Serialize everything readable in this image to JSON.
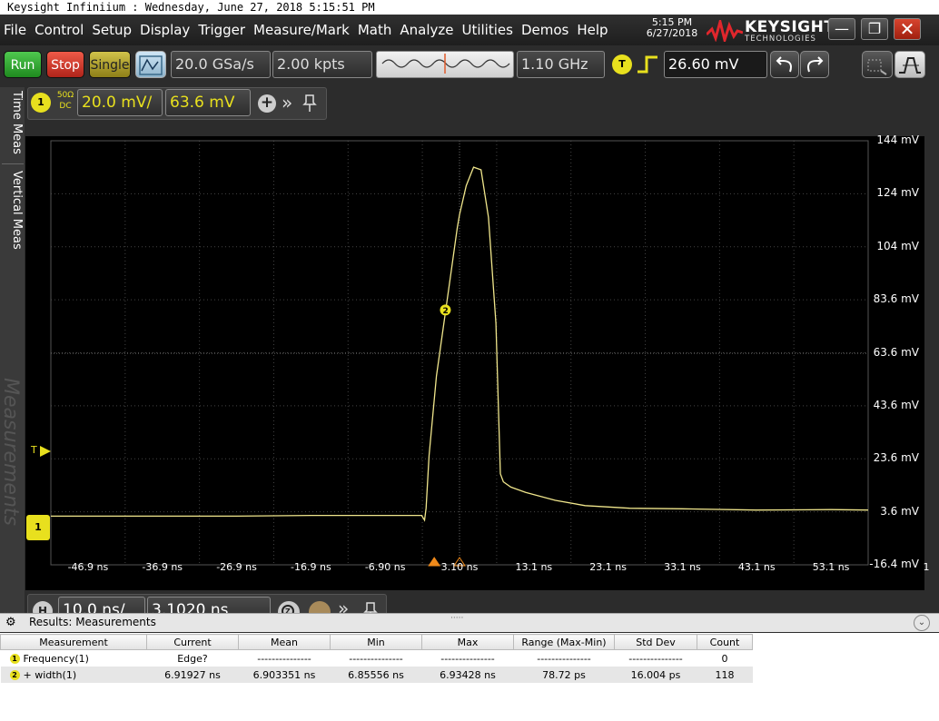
{
  "window": {
    "title": "Keysight Infiniium : Wednesday, June 27, 2018 5:15:51 PM"
  },
  "menu": [
    "File",
    "Control",
    "Setup",
    "Display",
    "Trigger",
    "Measure/Mark",
    "Math",
    "Analyze",
    "Utilities",
    "Demos",
    "Help"
  ],
  "clock": {
    "time": "5:15 PM",
    "date": "6/27/2018"
  },
  "brand": {
    "name": "KEYSIGHT",
    "sub": "TECHNOLOGIES"
  },
  "toolbar": {
    "run": "Run",
    "stop": "Stop",
    "single": "Single",
    "sample_rate": "20.0 GSa/s",
    "memory_depth": "2.00 kpts",
    "bandwidth": "1.10 GHz",
    "trigger_badge": "T",
    "trigger_level": "26.60 mV"
  },
  "channel": {
    "number": "1",
    "coupling_top": "50Ω",
    "coupling_bottom": "DC",
    "scale": "20.0 mV/",
    "offset": "63.6 mV"
  },
  "side_tabs": [
    "Time Meas",
    "Vertical Meas",
    "Measurements"
  ],
  "axes": {
    "y_labels": [
      "144 mV",
      "124 mV",
      "104 mV",
      "83.6 mV",
      "63.6 mV",
      "43.6 mV",
      "23.6 mV",
      "3.6 mV",
      "-16.4 mV"
    ],
    "x_labels": [
      "-46.9 ns",
      "-36.9 ns",
      "-26.9 ns",
      "-16.9 ns",
      "-6.90 ns",
      "3.10 ns",
      "13.1 ns",
      "23.1 ns",
      "33.1 ns",
      "43.1 ns",
      "53.1 ns"
    ],
    "extra_label": "1",
    "trigger_marker": "T",
    "marker_2": "2"
  },
  "timebase": {
    "badge": "H",
    "scale": "10.0 ns/",
    "position": "3.1020 ns"
  },
  "results": {
    "title": "Results: Measurements",
    "columns": [
      "Measurement",
      "Current",
      "Mean",
      "Min",
      "Max",
      "Range (Max-Min)",
      "Std Dev",
      "Count"
    ],
    "rows": [
      {
        "idx": "1",
        "cells": [
          "Frequency(1)",
          "Edge?",
          "---------------",
          "---------------",
          "---------------",
          "---------------",
          "---------------",
          "0"
        ]
      },
      {
        "idx": "2",
        "cells": [
          "+ width(1)",
          "6.91927 ns",
          "6.903351 ns",
          "6.85556 ns",
          "6.93428 ns",
          "78.72 ps",
          "16.004 ps",
          "118"
        ]
      }
    ]
  },
  "colors": {
    "trace": "#f0e68c",
    "channel": "#e8e01e",
    "run": "#2ea02e",
    "stop": "#d23a2a",
    "single": "#b8a82a"
  },
  "chart_data": {
    "type": "line",
    "xlabel": "",
    "ylabel": "",
    "xlim": [
      -51.9,
      58.1
    ],
    "ylim": [
      -16.4,
      144
    ],
    "x": [
      -51.9,
      -46.9,
      -36.9,
      -26.9,
      -16.9,
      -6.9,
      -2.0,
      -1.6,
      -1.4,
      -1.0,
      0.0,
      1.0,
      2.0,
      2.8,
      3.1,
      4.0,
      5.0,
      6.0,
      7.0,
      8.0,
      8.6,
      9.0,
      10.0,
      12.0,
      16.0,
      20.0,
      26.0,
      33.0,
      43.0,
      53.1,
      58.1
    ],
    "y": [
      2,
      2,
      2,
      2,
      2.3,
      2.3,
      2.3,
      0.5,
      5,
      25,
      55,
      75,
      95,
      111,
      116,
      127,
      134,
      133,
      115,
      75,
      18,
      15,
      13,
      11,
      8,
      6,
      5,
      4.8,
      4.3,
      4.5,
      4.3
    ]
  }
}
